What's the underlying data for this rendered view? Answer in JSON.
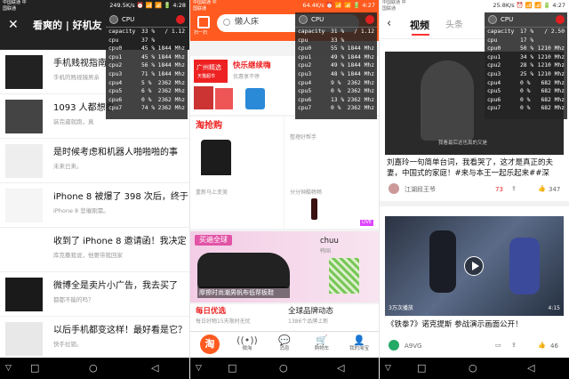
{
  "cpu_panels": [
    {
      "title": "CPU",
      "capacity": "33 %",
      "capacity_max": "/ 1.12",
      "cpu": "37 %",
      "cores": [
        [
          "cpu0",
          "45 %",
          "1844 Mhz"
        ],
        [
          "cpu1",
          "45 %",
          "1844 Mhz"
        ],
        [
          "cpu2",
          "56 %",
          "1844 Mhz"
        ],
        [
          "cpu3",
          "71 %",
          "1844 Mhz"
        ],
        [
          "cpu4",
          "5 %",
          "2362 Mhz"
        ],
        [
          "cpu5",
          "6 %",
          "2362 Mhz"
        ],
        [
          "cpu6",
          "0 %",
          "2362 Mhz"
        ],
        [
          "cpu7",
          "74 %",
          "2362 Mhz"
        ]
      ]
    },
    {
      "title": "CPU",
      "capacity": "31 %",
      "capacity_max": "/ 1.12",
      "cpu": "33 %",
      "cores": [
        [
          "cpu0",
          "55 %",
          "1844 Mhz"
        ],
        [
          "cpu1",
          "49 %",
          "1844 Mhz"
        ],
        [
          "cpu2",
          "49 %",
          "1844 Mhz"
        ],
        [
          "cpu3",
          "48 %",
          "1844 Mhz"
        ],
        [
          "cpu4",
          "9 %",
          "2362 Mhz"
        ],
        [
          "cpu5",
          "0 %",
          "2362 Mhz"
        ],
        [
          "cpu6",
          "13 %",
          "2362 Mhz"
        ],
        [
          "cpu7",
          "0 %",
          "2362 Mhz"
        ]
      ]
    },
    {
      "title": "CPU",
      "capacity": "17 %",
      "capacity_max": "/ 2.50",
      "cpu": "17 %",
      "cores": [
        [
          "cpu0",
          "50 %",
          "1210 Mhz"
        ],
        [
          "cpu1",
          "34 %",
          "1210 Mhz"
        ],
        [
          "cpu2",
          "28 %",
          "1210 Mhz"
        ],
        [
          "cpu3",
          "25 %",
          "1210 Mhz"
        ],
        [
          "cpu4",
          "0 %",
          "682 Mhz"
        ],
        [
          "cpu5",
          "0 %",
          "682 Mhz"
        ],
        [
          "cpu6",
          "0 %",
          "682 Mhz"
        ],
        [
          "cpu7",
          "0 %",
          "682 Mhz"
        ]
      ]
    }
  ],
  "status": {
    "p1": {
      "carrier": "中国联通 中国联通",
      "right": "249.5K/s ⏰ 📶 📶 🔋 4:28"
    },
    "p2": {
      "carrier": "中国联通 中国联通",
      "right": "64.4K/s ⏰ 📶 📶 🔋 4:27"
    },
    "p3": {
      "carrier": "中国联通 中国联通",
      "right": "25.8K/s ⏰ 📶 📶 🔋 4:27"
    }
  },
  "p1": {
    "close_icon": "✕",
    "title": "看爽的 | 好机友",
    "items": [
      {
        "title": "手机贱视指南",
        "sub": "手机的贱视镜男亲"
      },
      {
        "title": "1093 人都想看",
        "sub": "装完逼就跑，真"
      },
      {
        "title": "是时候考虑和机器人啪啪啪的事",
        "sub": "未来已来。"
      },
      {
        "title": "iPhone 8 被爆了 398 次后，终于",
        "sub": "iPhone 8 悲催刚需。"
      },
      {
        "title": "收到了 iPhone 8 邀请函！我决定",
        "sub": "库克撒我说，他要带我回家"
      },
      {
        "title": "微博全是卖片小广告，我去买了",
        "sub": "都都不能的吗？"
      },
      {
        "title": "以后手机都变这样！最好看是它？",
        "sub": "快手拉锁。"
      }
    ]
  },
  "p2": {
    "scan_label": "扫一扫",
    "search_placeholder": "懒人床",
    "banner_left": "广州精选",
    "banner_left_sub": "天猫超市",
    "banner_right": "快乐继续嗨",
    "banner_right_sub": "优惠享不停",
    "taoqianggou": "淘抢购",
    "deal_left": "重新马上变美",
    "deal_right": "分分钟酷畅畅",
    "mid_right": "整理好帮手",
    "live_badge": "LIVE",
    "global_title": "买遍全球",
    "global_caption": "摩擦时尚潮男帆布低帮板鞋",
    "chuu": "chuu",
    "chuu_sub": "韩国",
    "daily": "每日优选",
    "daily_sub": "每日好物15天限时无忧",
    "global_live": "全球品牌动态",
    "global_live_sub": "1386个品牌上新",
    "tabs": [
      {
        "icon": "淘",
        "label": ""
      },
      {
        "icon": "((•))",
        "label": "微淘"
      },
      {
        "icon": "💬",
        "label": "消息"
      },
      {
        "icon": "🛒",
        "label": "购物车"
      },
      {
        "icon": "👤",
        "label": "我的淘宝"
      }
    ]
  },
  "p3": {
    "back_icon": "‹",
    "tab_active": "视频",
    "tab_other": "头条",
    "video1_caption": "我看最后这也真的又是",
    "video1_title": "刘嘉玲一句简单台词，我看哭了，这才是真正的夫妻，中国式的家庭！#来与本王一起乐起来##深",
    "video1_author": "江湖段王爷",
    "video1_comments": "73",
    "video1_likes": "347",
    "video2_plays": "3万次播放",
    "video2_duration": "4:15",
    "video2_title": "《铁拳7》诺克提斯 参战演示画面公开！",
    "video2_author": "A9VG",
    "video2_comments": "",
    "video2_likes": "46"
  },
  "nav": {
    "back": "◁",
    "home": "○",
    "recent": "□",
    "extra": "▽"
  }
}
